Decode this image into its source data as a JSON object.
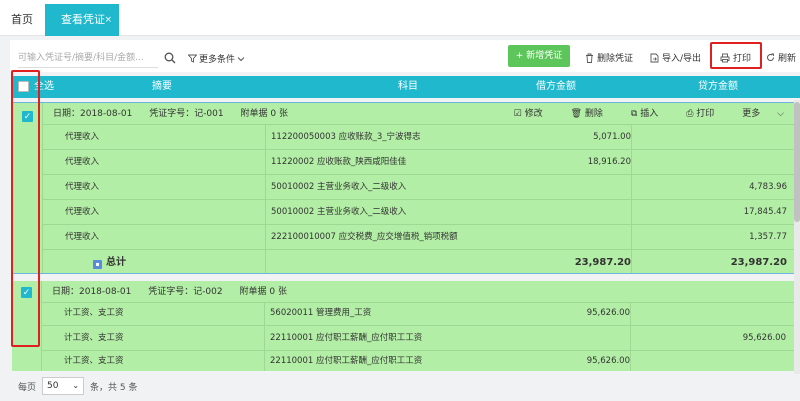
{
  "tabs": [
    {
      "label": "首页"
    },
    {
      "label": "查看凭证",
      "close": "×"
    }
  ],
  "toolbar": {
    "search_placeholder": "可输入凭证号/摘要/科目/金额...",
    "filter_label": "更多条件",
    "add_label": "+ 新增凭证",
    "delete_label": "删除凭证",
    "import_export_label": "导入/导出",
    "print_label": "打印",
    "refresh_label": "刷新"
  },
  "table_header": {
    "select_all": "全选",
    "summary": "摘要",
    "account": "科目",
    "debit": "借方金额",
    "credit": "贷方金额"
  },
  "vouchers": [
    {
      "checked": "✓",
      "date_label": "日期：2018-08-01",
      "number_label": "凭证字号：记-001",
      "attach_label": "附单据 0 张",
      "actions": {
        "edit": "修改",
        "delete": "删除",
        "insert": "插入",
        "print": "打印",
        "more": "更多"
      },
      "rows": [
        {
          "summary": "代理收入",
          "account": "112200050003 应收账款_3_宁波得志",
          "debit": "5,071.00",
          "credit": ""
        },
        {
          "summary": "代理收入",
          "account": "11220002 应收账款_陕西咸阳佳佳",
          "debit": "18,916.20",
          "credit": ""
        },
        {
          "summary": "代理收入",
          "account": "50010002 主营业务收入_二级收入",
          "debit": "",
          "credit": "4,783.96"
        },
        {
          "summary": "代理收入",
          "account": "50010002 主营业务收入_二级收入",
          "debit": "",
          "credit": "17,845.47"
        },
        {
          "summary": "代理收入",
          "account": "222100010007 应交税费_应交增值税_销项税额",
          "debit": "",
          "credit": "1,357.77"
        }
      ],
      "total": {
        "label": "总计",
        "debit": "23,987.20",
        "credit": "23,987.20"
      }
    },
    {
      "checked": "✓",
      "date_label": "日期：2018-08-01",
      "number_label": "凭证字号：记-002",
      "attach_label": "附单据 0 张",
      "rows": [
        {
          "summary": "计工资、支工资",
          "account": "56020011 管理费用_工资",
          "debit": "95,626.00",
          "credit": ""
        },
        {
          "summary": "计工资、支工资",
          "account": "22110001 应付职工薪酬_应付职工工资",
          "debit": "",
          "credit": "95,626.00"
        },
        {
          "summary": "计工资、支工资",
          "account": "22110001 应付职工薪酬_应付职工工资",
          "debit": "95,626.00",
          "credit": ""
        }
      ]
    }
  ],
  "pager": {
    "per_page_label": "每页",
    "per_page_value": "50",
    "arrow": "⌄",
    "count_label": "条，共 5 条"
  }
}
